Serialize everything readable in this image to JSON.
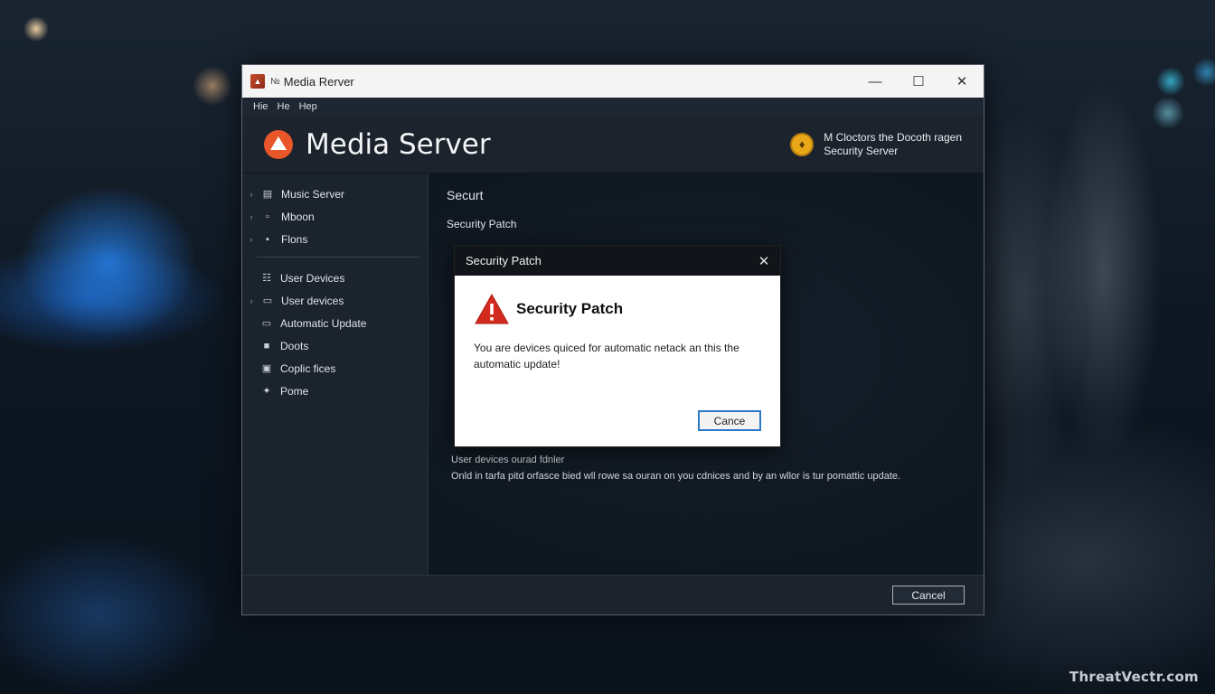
{
  "window": {
    "title": "Media Rerver",
    "title_glyph": "№",
    "app_icon_glyph": "▲",
    "controls": {
      "minimize": "—",
      "maximize": "☐",
      "close": "✕"
    }
  },
  "menu": [
    "Hie",
    "He",
    "Hep"
  ],
  "header": {
    "app_name": "Media Server",
    "right_line1": "M Cloctors the Docoth ragen",
    "right_line2": "Security Server",
    "right_icon": "shield-icon",
    "right_icon_glyph": "♦"
  },
  "sidebar": {
    "chevron": "›",
    "items": [
      {
        "label": "Music Server",
        "icon": "server-icon",
        "glyph": "▤"
      },
      {
        "label": "Mboon",
        "icon": "document-icon",
        "glyph": "▫"
      },
      {
        "label": "Flons",
        "icon": "folder-icon",
        "glyph": "▪"
      }
    ],
    "sub_items": [
      {
        "label": "User Devices",
        "icon": "devices-icon",
        "glyph": "☷"
      },
      {
        "label": "User devices",
        "icon": "monitor-icon",
        "glyph": "▭"
      },
      {
        "label": "Automatic Update",
        "icon": "update-icon",
        "glyph": "▭"
      },
      {
        "label": "Doots",
        "icon": "doc-icon",
        "glyph": "■"
      },
      {
        "label": "Coplic fices",
        "icon": "file-icon",
        "glyph": "▣"
      },
      {
        "label": "Pome",
        "icon": "plug-icon",
        "glyph": "✦"
      }
    ]
  },
  "content": {
    "title": "Securt",
    "subtitle": "Security Patch",
    "foot1": "User devices ourad fdnler",
    "foot2": "Onld in tarfa pitd orfasce bied wll rowe sa ouran on you cdnices and by an wllor is tur pomattic update."
  },
  "footer": {
    "cancel_label": "Cancel"
  },
  "dialog": {
    "title": "Security Patch",
    "close": "✕",
    "heading": "Security Patch",
    "message_line1": "You are devices quiced for automatic netack an this the",
    "message_line2": "automatic update!",
    "button_label": "Cance",
    "warning_icon": "warning-icon"
  },
  "watermark": "ThreatVectr.com",
  "colors": {
    "accent": "#e8562a",
    "dialog_button_border": "#2a79c8",
    "warning": "#d42a1e"
  }
}
